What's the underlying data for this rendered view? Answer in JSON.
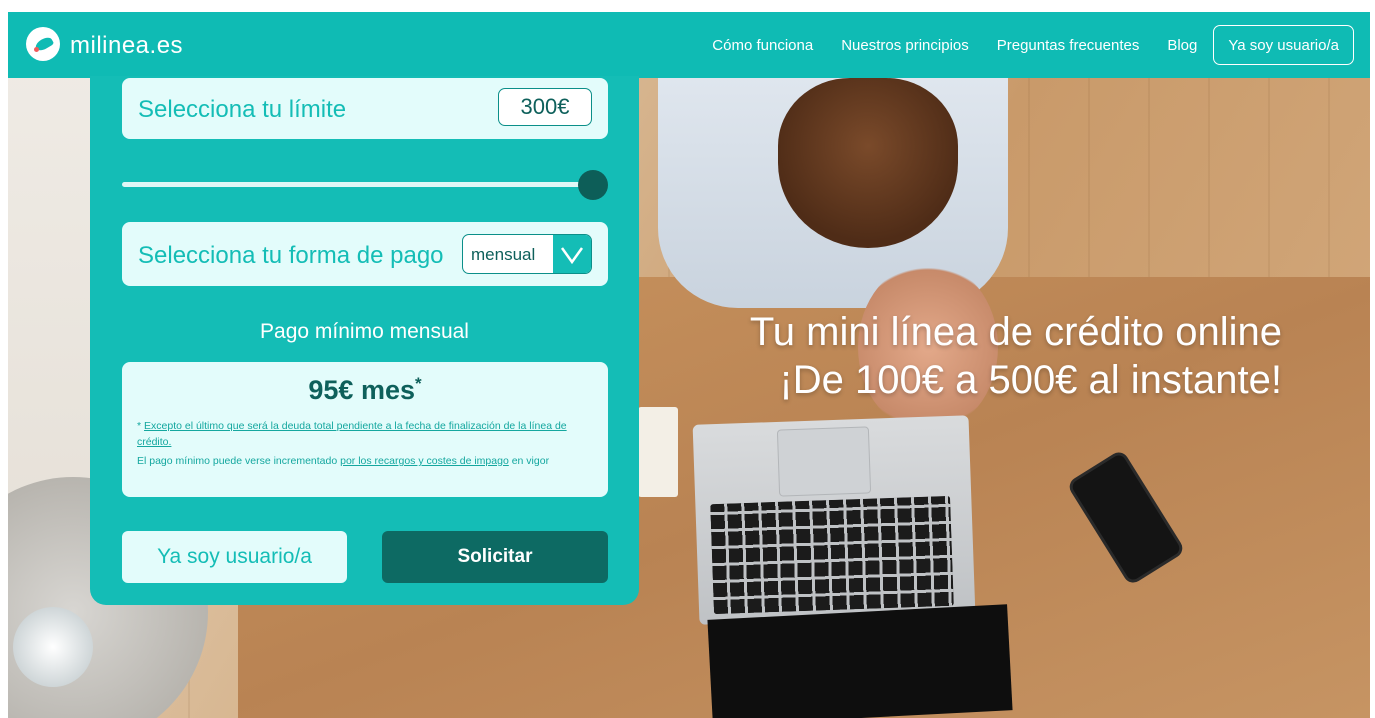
{
  "header": {
    "logo_text": "milinea.es",
    "nav": {
      "como_funciona": "Cómo funciona",
      "principios": "Nuestros principios",
      "preguntas": "Preguntas frecuentes",
      "blog": "Blog",
      "user_button": "Ya soy usuario/a"
    },
    "color": "#0fbbb4"
  },
  "calculator": {
    "limit_label": "Selecciona tu límite",
    "limit_value": "300€",
    "slider_fraction": 1.0,
    "payment_label": "Selecciona tu forma de pago",
    "payment_value": "mensual",
    "min_payment_title": "Pago mínimo mensual",
    "min_payment_amount": "95€ mes",
    "min_payment_mark": "*",
    "note1_prefix": "* ",
    "note1_link": "Excepto el último que será la deuda total pendiente a la fecha de finalización de la línea de crédito.",
    "note2_prefix": "El pago mínimo puede verse incrementado ",
    "note2_link": "por los recargos y costes de impago",
    "note2_suffix": " en vigor",
    "user_button": "Ya soy usuario/a",
    "apply_button": "Solicitar"
  },
  "hero": {
    "line1": "Tu mini línea de crédito online",
    "line2": "¡De 100€ a 500€ al instante!"
  },
  "colors": {
    "primary": "#14bdb6",
    "dark": "#0d6a63",
    "light": "#e3fcfb"
  }
}
